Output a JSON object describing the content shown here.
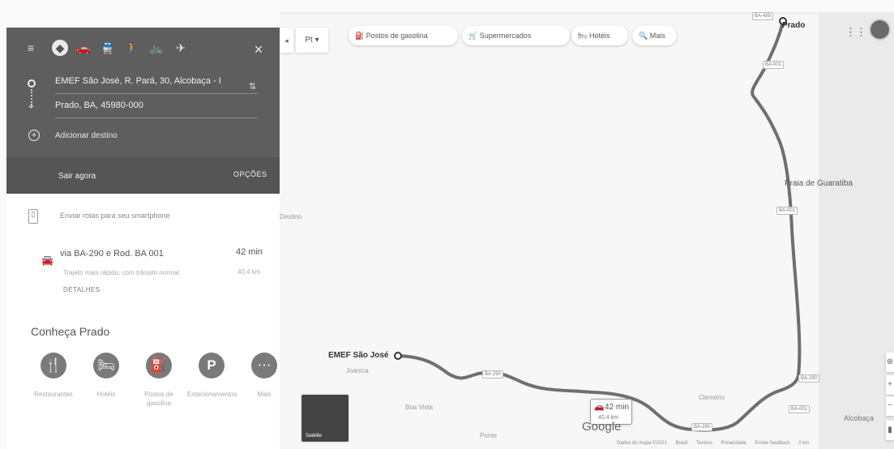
{
  "directions": {
    "origin": "EMEF São José, R. Pará, 30, Alcobaça - I",
    "destination": "Prado, BA, 45980-000",
    "add_destination": "Adicionar destino",
    "leave_now": "Sair agora",
    "options": "OPÇÕES",
    "send_to_phone": "Enviar rotas para seu smartphone",
    "close": "×",
    "route": {
      "via": "via BA-290 e Rod. BA 001",
      "time": "42 min",
      "description": "Trajeto mais rápido, com trânsito normal",
      "distance": "40,4 km",
      "details": "DETALHES"
    },
    "discover": {
      "title": "Conheça Prado",
      "categories": [
        {
          "label": "Restaurantes",
          "icon": "restaurant-icon"
        },
        {
          "label": "Hotéis",
          "icon": "hotel-icon"
        },
        {
          "label": "Postos de gasolina",
          "icon": "gas-station-icon"
        },
        {
          "label": "Estacionamentos",
          "icon": "parking-icon"
        },
        {
          "label": "Mais",
          "icon": "more-icon"
        }
      ]
    }
  },
  "map": {
    "language": "Pt",
    "chips": [
      "Postos de gasolina",
      "Supermercados",
      "Hotéis",
      "Mais"
    ],
    "labels": {
      "prado": "Prado",
      "praia": "Praia de Guaratiba",
      "destino": "Destino",
      "emef": "EMEF São José",
      "joanica": "Joanica",
      "boa_vista": "Boa Vista",
      "ponte": "Ponte",
      "clemerio": "Clemério",
      "alcobaca": "Alcobaça"
    },
    "roads": {
      "ba001": "BA-001",
      "ba290": "BA-290",
      "ba489": "BA-489"
    },
    "route_box": {
      "time": "42 min",
      "distance": "40,4 km"
    },
    "google": "Google",
    "satellite": "Satélite",
    "attribution": [
      "Dados do mapa ©2021",
      "Brasil",
      "Termos",
      "Privacidade",
      "Enviar feedback",
      "2 km"
    ]
  },
  "colors": {
    "header": "#5e5e5e",
    "route": "#6f6f6f"
  }
}
